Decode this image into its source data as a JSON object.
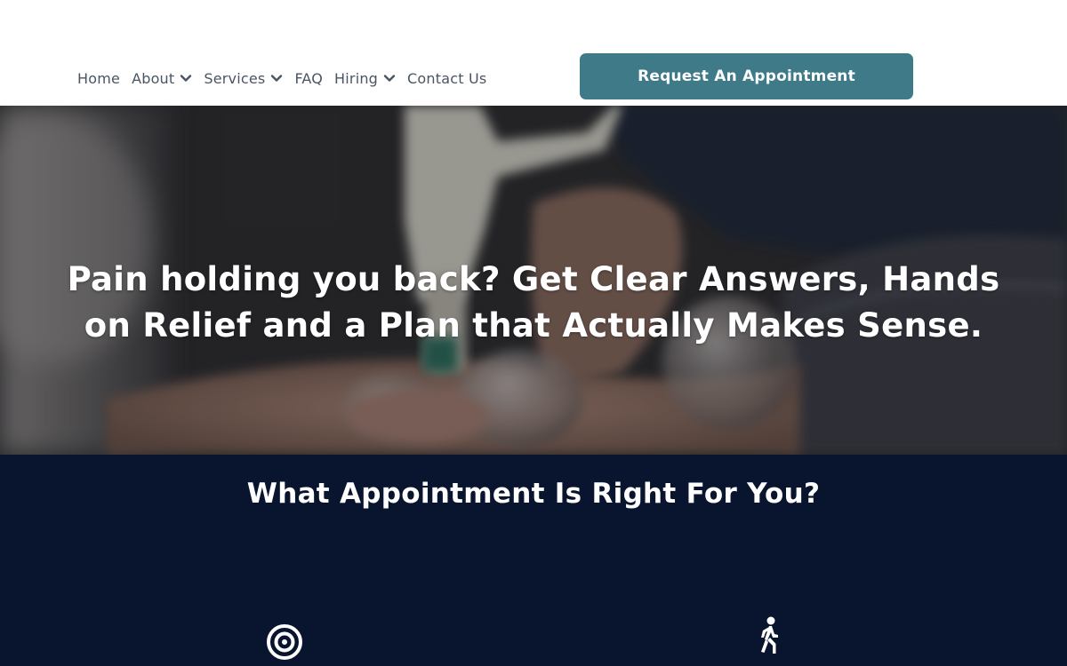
{
  "nav": {
    "items": [
      {
        "label": "Home",
        "dropdown": false
      },
      {
        "label": "About",
        "dropdown": true
      },
      {
        "label": "Services",
        "dropdown": true
      },
      {
        "label": "FAQ",
        "dropdown": false
      },
      {
        "label": "Hiring",
        "dropdown": true
      },
      {
        "label": "Contact Us",
        "dropdown": false
      }
    ],
    "cta_label": "Request An Appointment"
  },
  "hero": {
    "headline_line1": "Pain holding you back? Get Clear Answers, Hands",
    "headline_line2": "on Relief and a Plan that Actually Makes Sense."
  },
  "appointments": {
    "title": "What Appointment Is Right For You?",
    "icons": [
      "target-icon",
      "walking-person-icon"
    ]
  },
  "colors": {
    "accent": "#3e7a88",
    "nav_text": "#4a5563",
    "section_bg": "#09152e"
  }
}
